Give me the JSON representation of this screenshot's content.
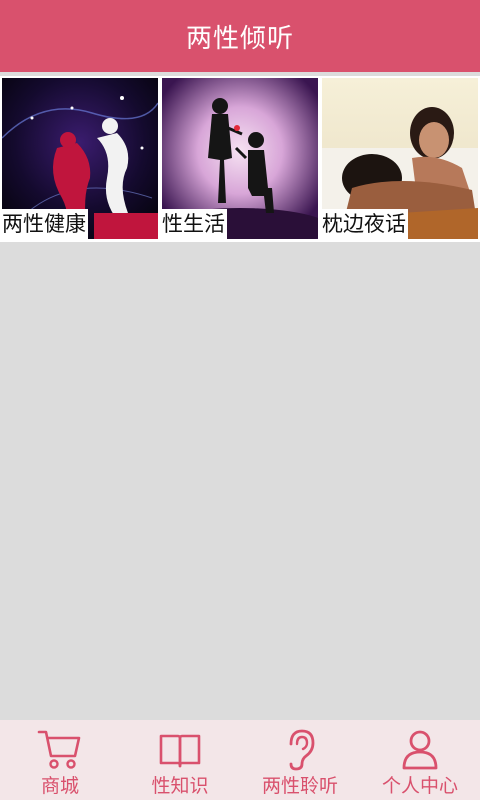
{
  "header": {
    "title": "两性倾听"
  },
  "tiles": [
    {
      "label": "两性健康"
    },
    {
      "label": "性生活"
    },
    {
      "label": "枕边夜话"
    }
  ],
  "tabbar": {
    "items": [
      {
        "label": "商城",
        "icon": "cart-icon"
      },
      {
        "label": "性知识",
        "icon": "book-icon"
      },
      {
        "label": "两性聆听",
        "icon": "ear-icon"
      },
      {
        "label": "个人中心",
        "icon": "person-icon"
      }
    ]
  },
  "colors": {
    "accent": "#d9516d",
    "tabbar_bg": "#f3e6e8",
    "content_bg": "#dcdcdc"
  }
}
